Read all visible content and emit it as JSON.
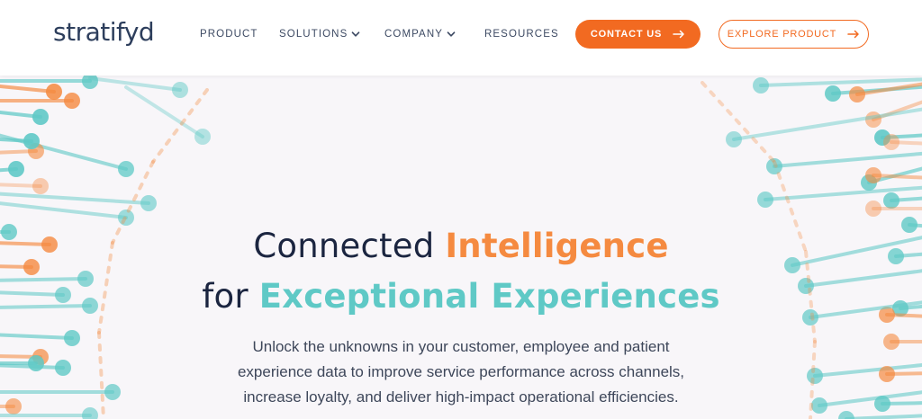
{
  "brand": {
    "logo_text": "stratifyd"
  },
  "nav": {
    "items": [
      {
        "label": "PRODUCT",
        "has_dropdown": false
      },
      {
        "label": "SOLUTIONS",
        "has_dropdown": true
      },
      {
        "label": "COMPANY",
        "has_dropdown": true
      },
      {
        "label": "RESOURCES",
        "has_dropdown": false
      }
    ],
    "contact_label": "CONTACT US",
    "explore_label": "EXPLORE PRODUCT"
  },
  "hero": {
    "title_line1_plain": "Connected ",
    "title_line1_accent": "Intelligence",
    "title_line2_plain": "for ",
    "title_line2_accent": "Exceptional Experiences",
    "subtitle_lines": [
      "Unlock the unknowns in your customer, employee and patient",
      "experience data to improve service performance across channels,",
      "increase loyalty, and deliver high-impact operational efficiencies."
    ]
  },
  "colors": {
    "brand_orange": "#f26a21",
    "accent_orange": "#f58a40",
    "accent_teal": "#5fc9c6",
    "navy_text": "#1b2540",
    "header_bg": "#ffffff",
    "hero_bg": "#f8f6f9"
  },
  "icons": {
    "button_arrow": "arrow-right-icon",
    "dropdown": "chevron-down-icon"
  }
}
